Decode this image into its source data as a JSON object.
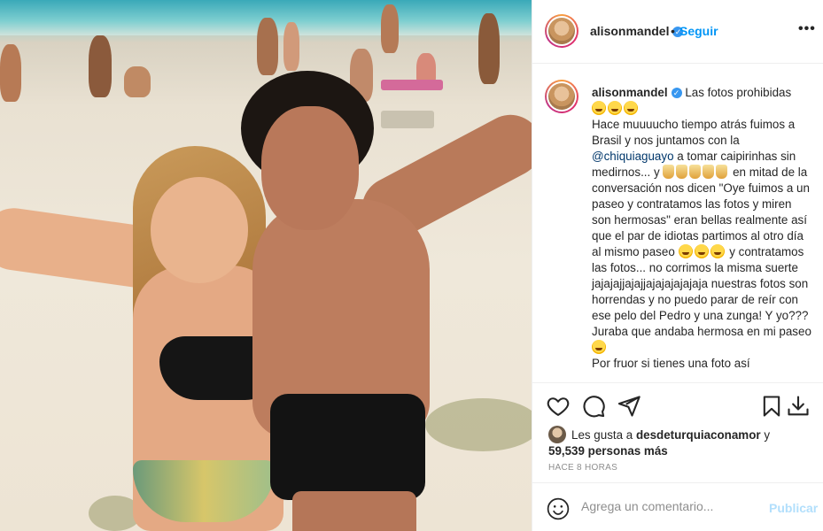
{
  "post": {
    "username": "alisonmandel",
    "follow_label": "Seguir",
    "separator": "•"
  },
  "caption": {
    "username": "alisonmandel",
    "intro": "Las fotos prohibidas",
    "line1": "Hace muuuucho tiempo atrás fuimos a Brasil y nos juntamos con la ",
    "mention": "@chiquiaguayo",
    "line2": " a tomar caipirinhas sin medirnos... y ",
    "line3": " en mitad de la conversación nos dicen \"Oye fuimos a un paseo y contratamos las fotos y miren son hermosas\" eran bellas realmente así que el par de idiotas partimos al otro día al mismo paseo ",
    "line4": " y contratamos las fotos... no corrimos la misma suerte jajajajjajajjajajajajajaja nuestras fotos son horrendas y no puedo parar de reír con ese pelo del Pedro y una zunga! Y yo??? Juraba que andaba hermosa en mi paseo ",
    "line5": "Por fruor si tienes una foto así"
  },
  "likes": {
    "prefix": "Les gusta a ",
    "liker": "desdeturquiaconamor",
    "middle": " y ",
    "count": "59,539 personas más"
  },
  "timestamp": "HACE 8 HORAS",
  "comment": {
    "placeholder": "Agrega un comentario...",
    "post_label": "Publicar"
  },
  "icons": [
    "heart-icon",
    "comment-icon",
    "share-icon",
    "bookmark-icon",
    "save-to-collection-icon",
    "smile-icon",
    "more-options-icon",
    "verified-badge-icon"
  ],
  "colors": {
    "link": "#0095f6",
    "mention": "#00376b",
    "verified": "#3897f0",
    "muted": "#8e8e8e",
    "post_disabled": "#b2dffc"
  }
}
